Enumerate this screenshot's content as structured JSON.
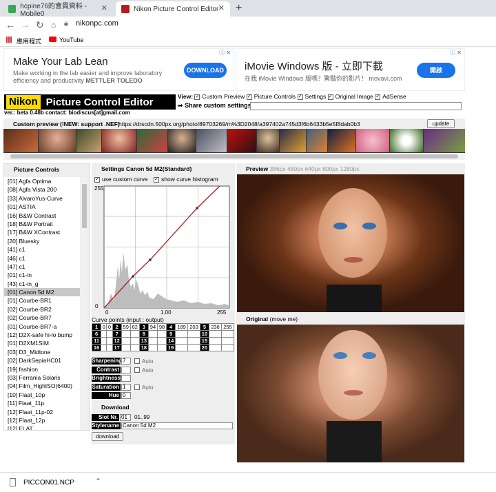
{
  "browser": {
    "tabs": [
      {
        "title": "hcpine76的會員資料 - Mobile0"
      },
      {
        "title": "Nikon Picture Control Editor"
      }
    ],
    "url": "nikonpc.com",
    "bookmarks": [
      {
        "label": "應用程式"
      },
      {
        "label": "YouTube"
      }
    ]
  },
  "ads": [
    {
      "headline": "Make Your Lab Lean",
      "body": "Make working in the lab easier and improve laboratory efficiency and productivity",
      "brand": "METTLER TOLEDO",
      "cta": "DOWNLOAD"
    },
    {
      "headline": "iMovie Windows 版 - 立即下載",
      "body": "在我 iMovie Windows 版嗎？驚豔你的影片！",
      "brand": "movavi.com",
      "cta": "開啟"
    }
  ],
  "app": {
    "logo_nikon": "Nikon",
    "logo_title": "Picture Control Editor",
    "version_line": "ver.: beta 0.48b contact: biodiscus[at]gmail.com",
    "view_label": "View:",
    "view_options": [
      "Custom Preview",
      "Picture Controls",
      "Settings",
      "Original Image",
      "AdSense"
    ],
    "share_label": "Share custom settings",
    "custom_preview_label": "Custom preview (!NEW: support .NEF)",
    "custom_preview_url": "https://drscdn.500px.org/photo/89703269/m%3D2048/a397402a745d3f6b6433b5e5f8dab0b3",
    "update_button": "update"
  },
  "picture_controls": {
    "title": "Picture Controls",
    "items": [
      "[01] Agfa Optima",
      "[08] Agfa Vista 200",
      "[33] AlvaroYus-Curve",
      "[01] ASTIA",
      "[16] B&W Contrast",
      "[18] B&W Portrait",
      "[17] B&W XContrast",
      "[20] Bluesky",
      "[41] c1",
      "[46] c1",
      "[47] c1",
      "[01] c1-in",
      "[43] c1-in_g",
      "[01] Canon 5d M2",
      "[01] Courbe-BR1",
      "[02] Courbe-BR2",
      "[02] Courbe-BR7",
      "[01] Courbe-BR7-a",
      "[12] D2X-safe hi-lo bump",
      "[01] D2XM1SIM",
      "[03] D3_Midtone",
      "[02] DarkSepiaHC01",
      "[19] fashion",
      "[03] Ferrania Solaris",
      "[04] Film_HighISO(6400)",
      "[10] Flaat_10p",
      "[11] Flaat_11p",
      "[12] Flaat_11p-02",
      "[12] Flaat_12p",
      "[12] FLAT"
    ],
    "selected_index": 13
  },
  "settings": {
    "title": "Settings Canon 5d M2(Standard)",
    "use_custom_curve": "use custom curve",
    "show_histogram": "show curve histogram",
    "curve_top_label": "255",
    "curve_bottom_label": "0",
    "x_axis_left": "0",
    "x_axis_mid": "1.00",
    "x_axis_right": "255",
    "curve_points_label": "Curve points (input : output)",
    "curve_points": [
      {
        "n": "1",
        "in": "0",
        "out": "0"
      },
      {
        "n": "2",
        "in": "59",
        "out": "62"
      },
      {
        "n": "3",
        "in": "94",
        "out": "98"
      },
      {
        "n": "4",
        "in": "189",
        "out": "203"
      },
      {
        "n": "5",
        "in": "236",
        "out": "255"
      },
      {
        "n": "6",
        "in": "",
        "out": ""
      },
      {
        "n": "7",
        "in": "",
        "out": ""
      },
      {
        "n": "8",
        "in": "",
        "out": ""
      },
      {
        "n": "9",
        "in": "",
        "out": ""
      },
      {
        "n": "10",
        "in": "",
        "out": ""
      },
      {
        "n": "11",
        "in": "",
        "out": ""
      },
      {
        "n": "12",
        "in": "",
        "out": ""
      },
      {
        "n": "13",
        "in": "",
        "out": ""
      },
      {
        "n": "14",
        "in": "",
        "out": ""
      },
      {
        "n": "15",
        "in": "",
        "out": ""
      },
      {
        "n": "16",
        "in": "",
        "out": ""
      },
      {
        "n": "17",
        "in": "",
        "out": ""
      },
      {
        "n": "18",
        "in": "",
        "out": ""
      },
      {
        "n": "19",
        "in": "",
        "out": ""
      },
      {
        "n": "20",
        "in": "",
        "out": ""
      }
    ],
    "adjustments": [
      {
        "label": "Sharpening",
        "value": "7",
        "auto": "Auto"
      },
      {
        "label": "Contrast",
        "value": "",
        "auto": "Auto"
      },
      {
        "label": "Brightness",
        "value": "",
        "auto": ""
      },
      {
        "label": "Saturation",
        "value": "1",
        "auto": "Auto"
      },
      {
        "label": "Hue",
        "value": "0",
        "auto": ""
      }
    ],
    "download_title": "Download",
    "slot_label": "Slot Nr.",
    "slot_value": "01",
    "slot_range": "01..99",
    "stylename_label": "Stylename",
    "stylename_value": "Canon 5d M2",
    "download_button": "download"
  },
  "preview": {
    "title": "Preview",
    "sizes": "386px 480px 640px 800px 1280px",
    "original_title": "Original",
    "original_hint": "(move me)"
  },
  "download_bar": {
    "filename": "PICCON01.NCP"
  }
}
